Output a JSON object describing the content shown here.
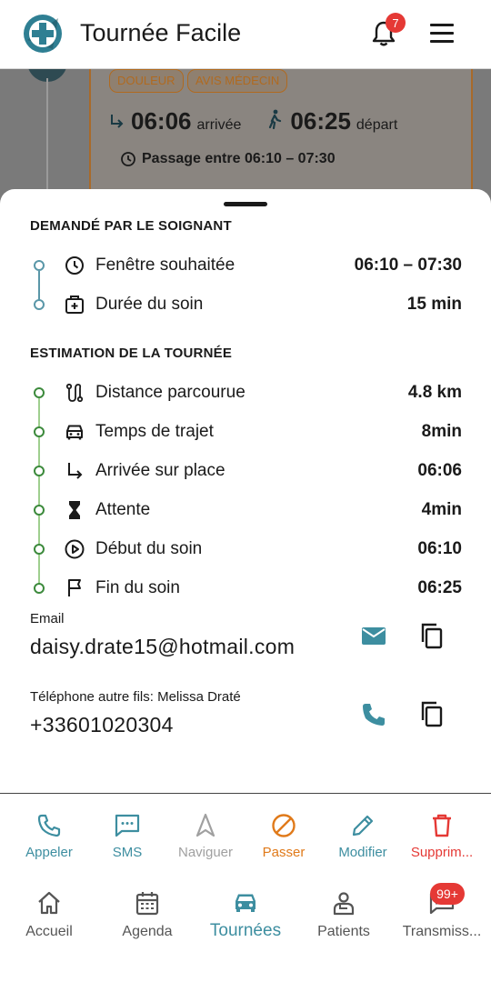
{
  "header": {
    "title": "Tournée Facile",
    "notification_count": "7"
  },
  "background_card": {
    "tags": [
      "DOULEUR",
      "AVIS MÉDECIN"
    ],
    "arrival_time": "06:06",
    "arrival_label": "arrivée",
    "departure_time": "06:25",
    "departure_label": "départ",
    "passage": "Passage entre 06:10 – 07:30"
  },
  "requested": {
    "title": "DEMANDÉ PAR LE SOIGNANT",
    "rows": [
      {
        "icon": "clock-icon",
        "label": "Fenêtre souhaitée",
        "value": "06:10 – 07:30"
      },
      {
        "icon": "medical-bag-icon",
        "label": "Durée du soin",
        "value": "15 min"
      }
    ]
  },
  "estimation": {
    "title": "ESTIMATION DE LA TOURNÉE",
    "rows": [
      {
        "icon": "route-icon",
        "label": "Distance parcourue",
        "value": "4.8 km"
      },
      {
        "icon": "car-icon",
        "label": "Temps de trajet",
        "value": "8min"
      },
      {
        "icon": "arrival-arrow-icon",
        "label": "Arrivée sur place",
        "value": "06:06"
      },
      {
        "icon": "hourglass-icon",
        "label": "Attente",
        "value": "4min"
      },
      {
        "icon": "play-circle-icon",
        "label": "Début du soin",
        "value": "06:10"
      },
      {
        "icon": "flag-icon",
        "label": "Fin du soin",
        "value": "06:25"
      }
    ]
  },
  "contacts": {
    "email_label": "Email",
    "email_value": "daisy.drate15@hotmail.com",
    "phone_label": "Téléphone autre fils: Melissa Draté",
    "phone_value": "+33601020304"
  },
  "actions": [
    {
      "label": "Appeler",
      "color": "#3d8ea0"
    },
    {
      "label": "SMS",
      "color": "#3d8ea0"
    },
    {
      "label": "Naviguer",
      "color": "#a0a0a0"
    },
    {
      "label": "Passer",
      "color": "#e07a1a"
    },
    {
      "label": "Modifier",
      "color": "#3d8ea0"
    },
    {
      "label": "Supprim...",
      "color": "#e53935"
    }
  ],
  "nav": {
    "items": [
      {
        "label": "Accueil"
      },
      {
        "label": "Agenda"
      },
      {
        "label": "Tournées"
      },
      {
        "label": "Patients"
      },
      {
        "label": "Transmiss..."
      }
    ],
    "transmissions_badge": "99+"
  },
  "colors": {
    "accent": "#3d8ea0",
    "requested_line": "#5a97a8",
    "estimation_line": "#3c8a3c",
    "danger": "#e53935",
    "warning": "#e07a1a"
  }
}
